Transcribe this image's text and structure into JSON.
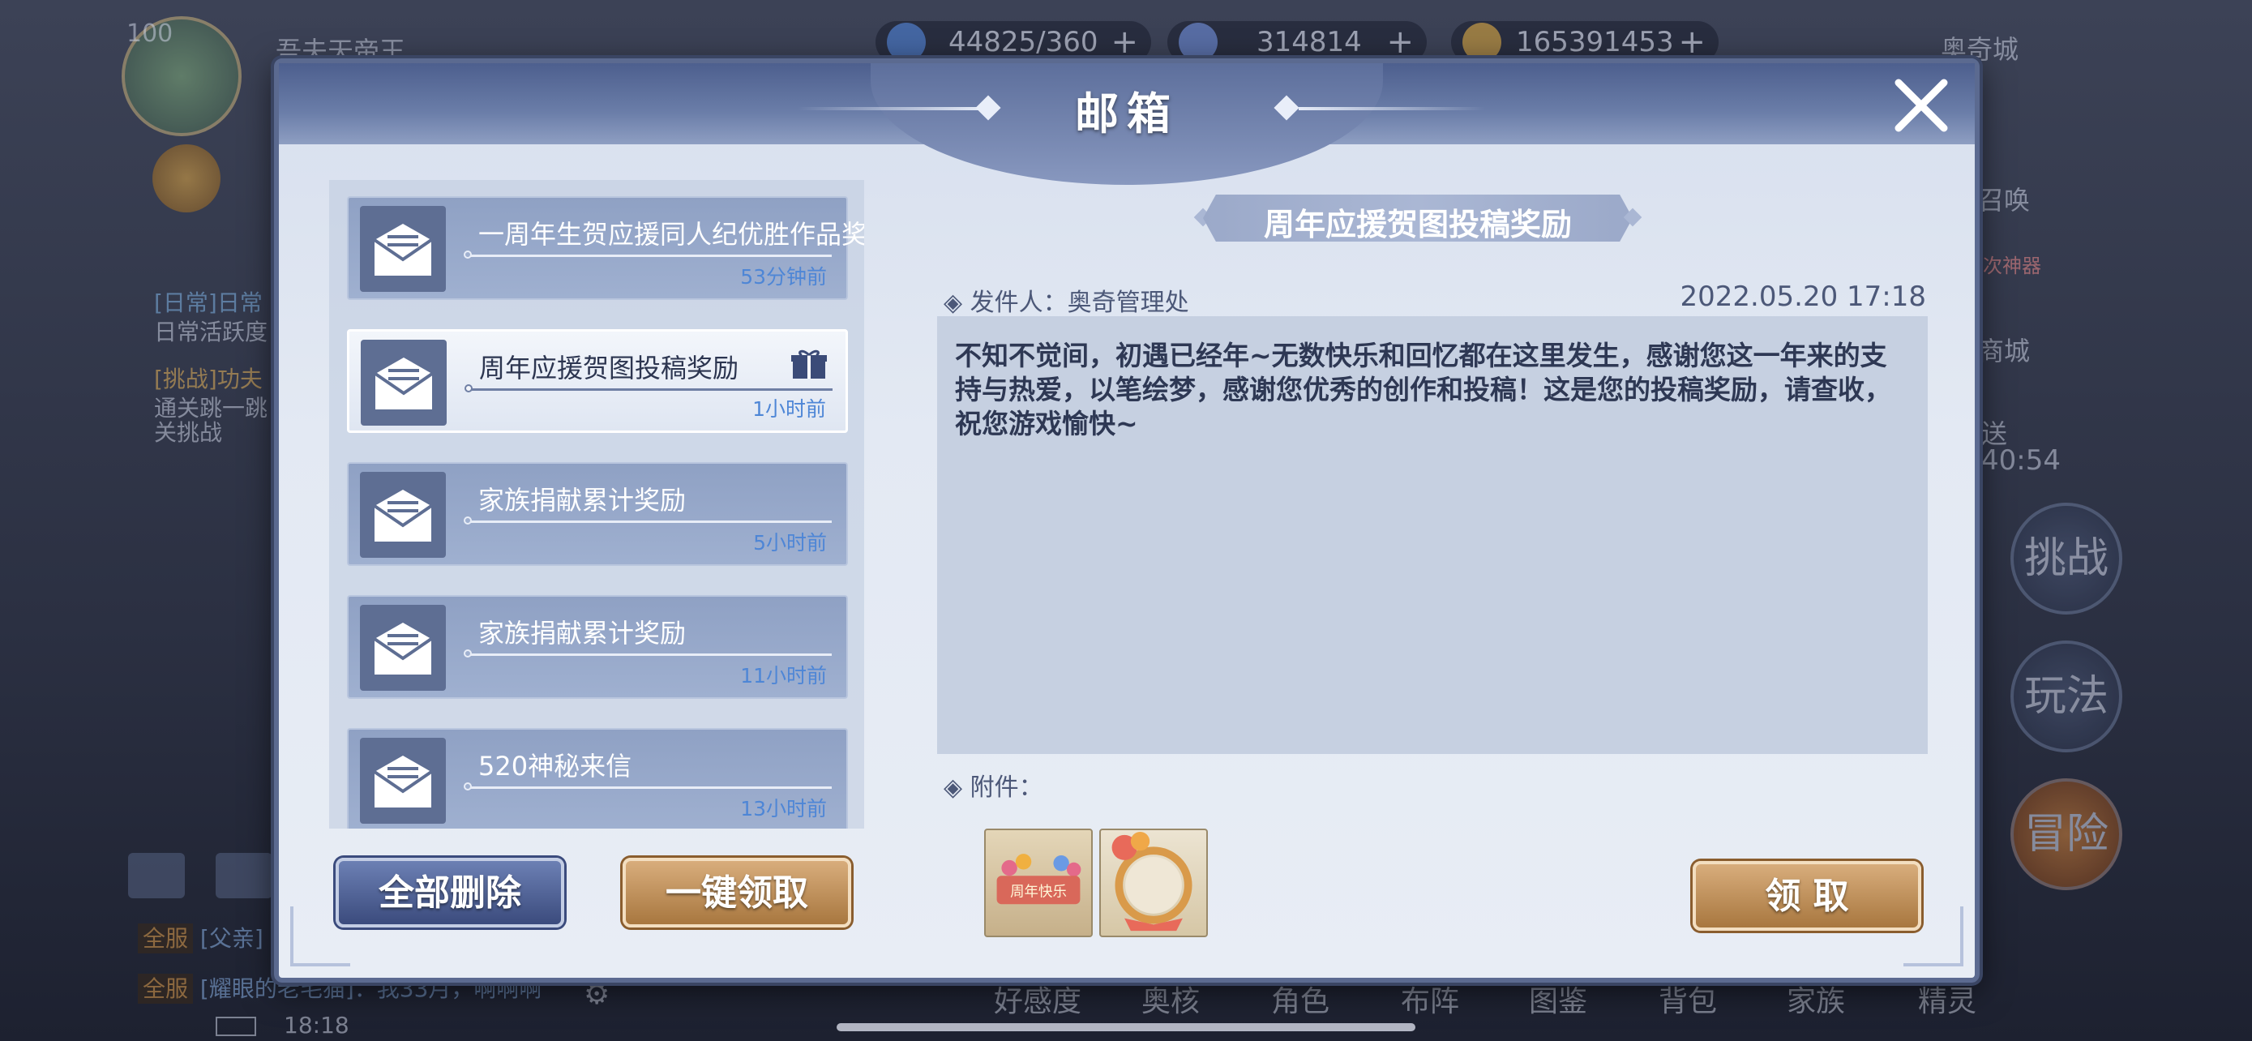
{
  "background": {
    "player_level": "100",
    "player_name": "吾夫天帝王",
    "resources": [
      {
        "icon": "stamina-icon",
        "value": "44825/360"
      },
      {
        "icon": "diamond-icon",
        "value": "314814"
      },
      {
        "icon": "gold-coin-icon",
        "value": "165391453"
      }
    ],
    "location": "奥奇城",
    "side_labels": [
      "召唤",
      "商城"
    ],
    "side_badge": "次神器",
    "left_tasks": [
      {
        "tag": "[日常]",
        "title": "日常",
        "desc": "日常活跃度"
      },
      {
        "tag": "[挑战]",
        "title": "功夫",
        "desc": "通关跳一跳",
        "desc2": "关挑战"
      }
    ],
    "timer_label": "送",
    "timer": "40:54",
    "side_buttons": [
      "挑战",
      "玩法",
      "冒险"
    ],
    "chat": [
      {
        "tag": "全服",
        "text": "[父亲]"
      },
      {
        "tag": "全服",
        "text": "[耀眼的老毛猫]：我33月，啊啊啊"
      }
    ],
    "clock": "18:18",
    "bottom_tabs": [
      "好感度",
      "奥核",
      "角色",
      "布阵",
      "图鉴",
      "背包",
      "家族",
      "精灵"
    ]
  },
  "dialog": {
    "title": "邮箱",
    "mails": [
      {
        "title": "一周年生贺应援同人纪优胜作品奖",
        "time": "53分钟前",
        "selected": false,
        "gift": false
      },
      {
        "title": "周年应援贺图投稿奖励",
        "time": "1小时前",
        "selected": true,
        "gift": true
      },
      {
        "title": "家族捐献累计奖励",
        "time": "5小时前",
        "selected": false,
        "gift": false
      },
      {
        "title": "家族捐献累计奖励",
        "time": "11小时前",
        "selected": false,
        "gift": false
      },
      {
        "title": "520神秘来信",
        "time": "13小时前",
        "selected": false,
        "gift": false
      }
    ],
    "delete_all_label": "全部删除",
    "claim_all_label": "一键领取",
    "detail": {
      "subject": "周年应援贺图投稿奖励",
      "sender_label": "◈ 发件人：奥奇管理处",
      "date": "2022.05.20  17:18",
      "body": "不知不觉间，初遇已经年~无数快乐和回忆都在这里发生，感谢您这一年来的支持与热爱，以笔绘梦，感谢您优秀的创作和投稿！这是您的投稿奖励，请查收，祝您游戏愉快~",
      "attachments_label": "◈ 附件：",
      "attachments": [
        {
          "icon": "anniversary-banner-icon",
          "text": "周年快乐"
        },
        {
          "icon": "avatar-frame-icon"
        }
      ],
      "claim_label": "领 取"
    }
  }
}
